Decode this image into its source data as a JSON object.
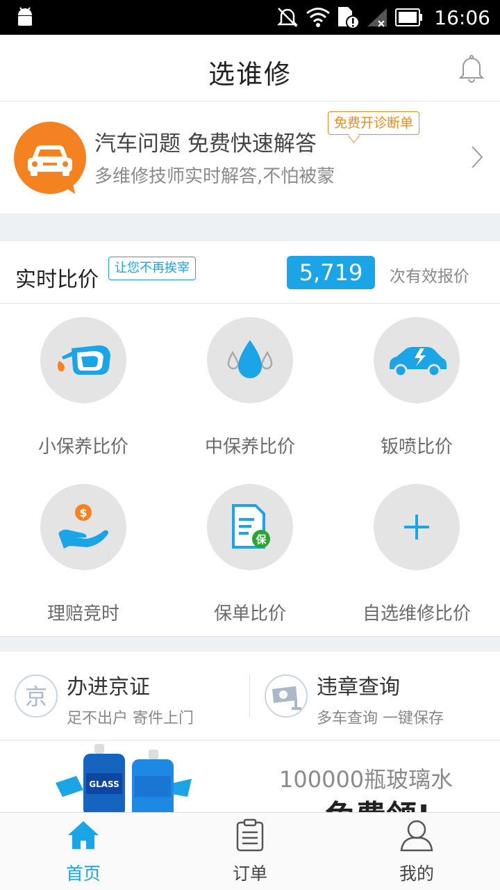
{
  "status_bar": {
    "time": "16:06",
    "icons": [
      "android-icon",
      "mute-icon",
      "wifi-icon",
      "sim-alert-icon",
      "no-signal-icon",
      "battery-icon"
    ]
  },
  "header": {
    "title": "选谁修",
    "right_icon": "bell-icon"
  },
  "consult": {
    "icon": "car-chat-icon",
    "headline": "汽车问题 免费快速解答",
    "subtitle": "多维修技师实时解答,不怕被蒙",
    "tag": "免费开诊断单"
  },
  "compare": {
    "label": "实时比价",
    "tag": "让您不再挨宰",
    "count": "5,719",
    "count_suffix": "次有效报价",
    "items": [
      {
        "label": "小保养比价",
        "icon": "oil-can-icon"
      },
      {
        "label": "中保养比价",
        "icon": "drops-icon"
      },
      {
        "label": "钣喷比价",
        "icon": "car-paint-icon"
      },
      {
        "label": "理赔竞时",
        "icon": "hand-coin-icon"
      },
      {
        "label": "保单比价",
        "icon": "policy-document-icon",
        "badge": "保"
      },
      {
        "label": "自选维修比价",
        "icon": "plus-icon"
      }
    ]
  },
  "services": [
    {
      "title": "办进京证",
      "subtitle": "足不出户 寄件上门",
      "icon_text": "京"
    },
    {
      "title": "违章查询",
      "subtitle": "多车查询 一键保存",
      "icon": "camera-icon"
    }
  ],
  "promo": {
    "text": "100000瓶玻璃水",
    "big_text": "免费领!",
    "bottle_label": "GLASS"
  },
  "bottom_nav": [
    {
      "label": "首页",
      "icon": "home-icon",
      "active": true
    },
    {
      "label": "订单",
      "icon": "clipboard-icon",
      "active": false
    },
    {
      "label": "我的",
      "icon": "user-icon",
      "active": false
    }
  ],
  "colors": {
    "accent": "#1ca5e6",
    "orange": "#f58220",
    "gray_circle": "#e4e4e4"
  }
}
